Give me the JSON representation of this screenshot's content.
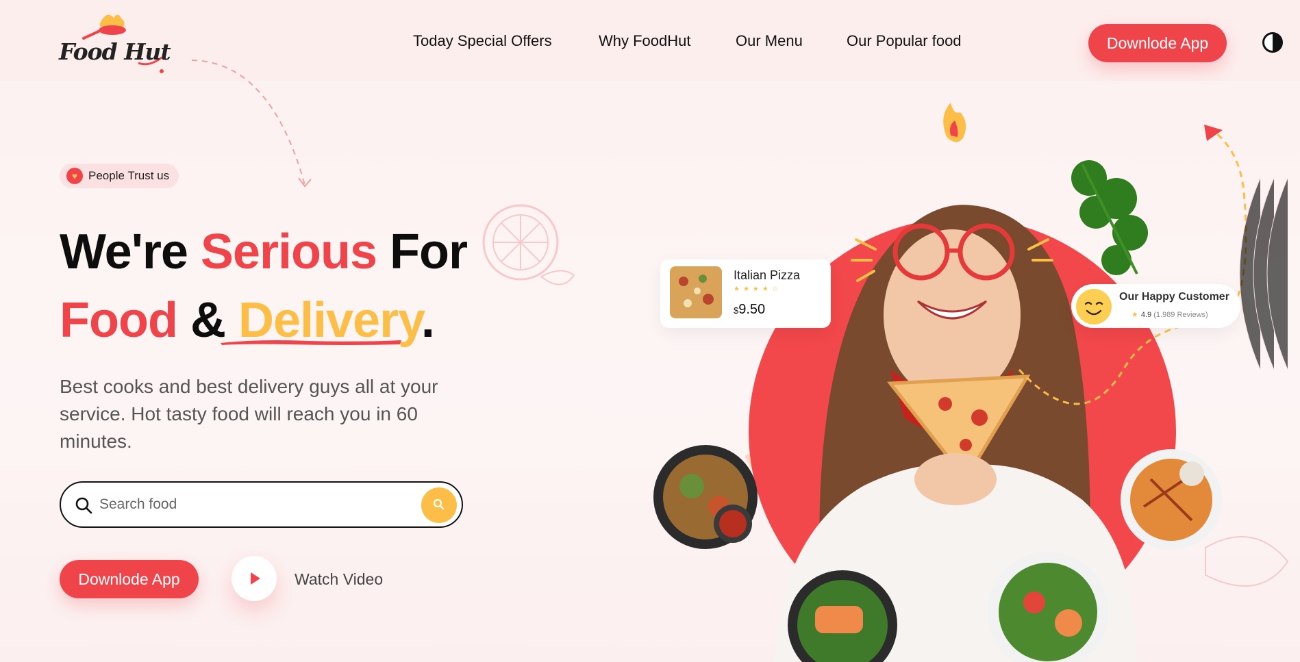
{
  "brand": {
    "logo_text": "Food Hut"
  },
  "nav": {
    "items": [
      {
        "label": "Today Special Offers"
      },
      {
        "label": "Why FoodHut"
      },
      {
        "label": "Our Menu"
      },
      {
        "label": "Our Popular food"
      }
    ],
    "download_label": "Downlode App"
  },
  "hero": {
    "badge": "People Trust us",
    "headline": {
      "w1": "We're",
      "w2": "Serious",
      "w3": "For",
      "w4": "Food",
      "w5": "&",
      "w6": "Delivery",
      "w7": "."
    },
    "description": "Best cooks and best delivery guys all at your service. Hot tasty food will reach you in 60 minutes.",
    "search": {
      "placeholder": "Search food"
    },
    "download_label": "Downlode App",
    "watch_label": "Watch Video"
  },
  "cards": {
    "pizza": {
      "name": "Italian Pizza",
      "currency": "$",
      "price": "9.50",
      "rating": 4
    },
    "customer": {
      "title": "Our Happy Customer",
      "rating": "4.9",
      "reviews": "(1.989 Reviews)"
    }
  },
  "colors": {
    "accent": "#f0444b",
    "yellow": "#fcbe47",
    "background": "#fdf1f1"
  },
  "icons": [
    "heart-icon",
    "search-icon",
    "play-icon",
    "fire-icon",
    "smile-icon",
    "theme-toggle-icon",
    "star-icon"
  ]
}
